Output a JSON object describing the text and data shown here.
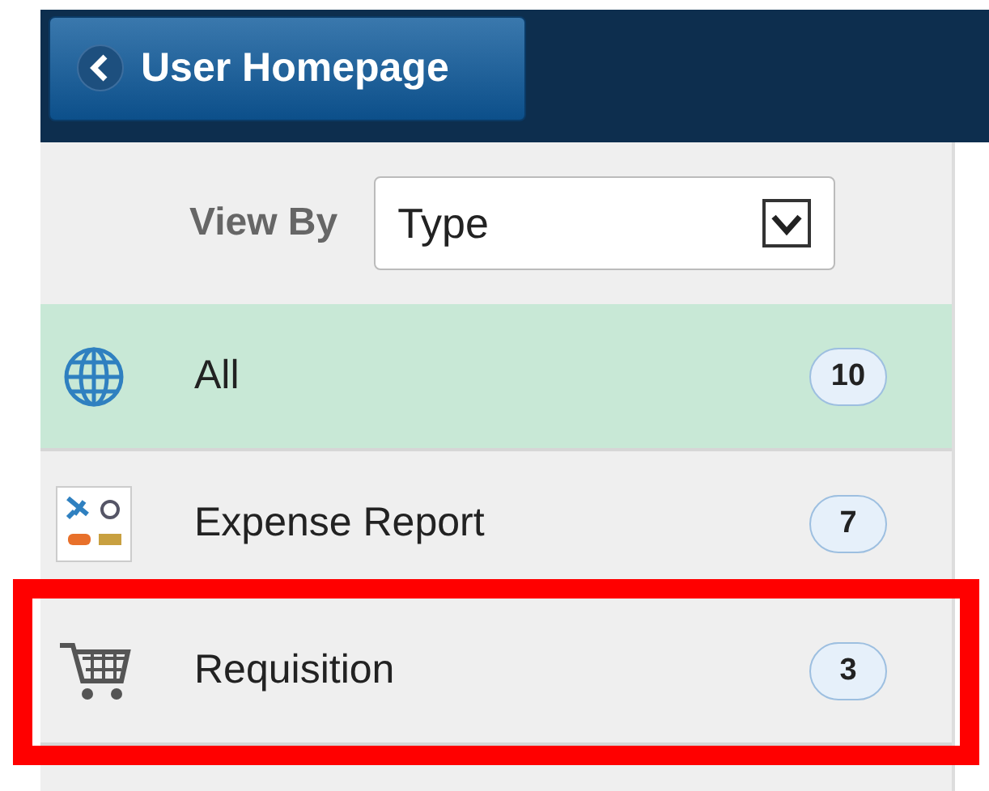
{
  "header": {
    "back_button": "User Homepage"
  },
  "view_by": {
    "label": "View By",
    "value": "Type"
  },
  "items": [
    {
      "kind": "globe",
      "label": "All",
      "count": "10",
      "selected": true,
      "highlighted": false
    },
    {
      "kind": "expense",
      "label": "Expense Report",
      "count": "7",
      "selected": false,
      "highlighted": false
    },
    {
      "kind": "cart",
      "label": "Requisition",
      "count": "3",
      "selected": false,
      "highlighted": true
    }
  ]
}
